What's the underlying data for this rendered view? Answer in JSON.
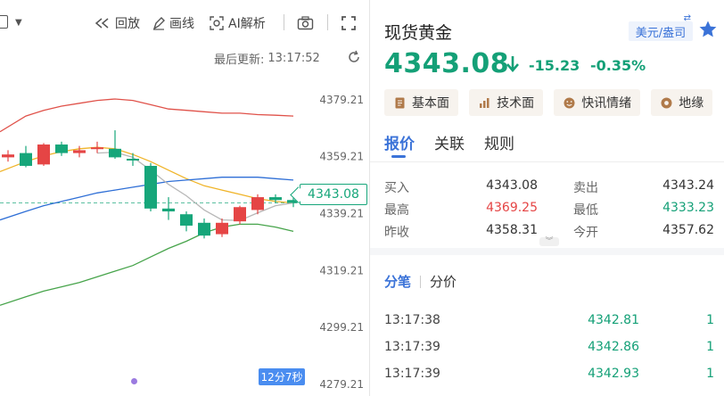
{
  "toolbar": {
    "replay_label": "回放",
    "draw_label": "画线",
    "ai_label": "AI解析"
  },
  "chart": {
    "last_update_label": "最后更新:",
    "last_update_time": "13:17:52",
    "current_price_tag": "4343.08",
    "countdown": "12分7秒"
  },
  "chart_data": {
    "type": "line",
    "title": "",
    "y_tick_labels": [
      "4379.21",
      "4359.21",
      "4339.21",
      "4319.21",
      "4299.21",
      "4279.21"
    ],
    "ylim": [
      4279.21,
      4389.21
    ],
    "candles": [
      {
        "open": 4359.0,
        "close": 4360.0,
        "high": 4361.5,
        "low": 4357.5
      },
      {
        "open": 4360.5,
        "close": 4356.0,
        "high": 4363.0,
        "low": 4355.5
      },
      {
        "open": 4356.5,
        "close": 4363.5,
        "high": 4364.0,
        "low": 4356.0
      },
      {
        "open": 4363.5,
        "close": 4360.5,
        "high": 4364.5,
        "low": 4359.5
      },
      {
        "open": 4360.5,
        "close": 4361.5,
        "high": 4363.0,
        "low": 4359.0
      },
      {
        "open": 4362.0,
        "close": 4362.5,
        "high": 4364.5,
        "low": 4360.5
      },
      {
        "open": 4362.0,
        "close": 4359.0,
        "high": 4368.5,
        "low": 4358.5
      },
      {
        "open": 4358.5,
        "close": 4358.0,
        "high": 4360.5,
        "low": 4356.0
      },
      {
        "open": 4356.0,
        "close": 4341.0,
        "high": 4357.0,
        "low": 4340.0
      },
      {
        "open": 4341.0,
        "close": 4340.0,
        "high": 4345.0,
        "low": 4337.0
      },
      {
        "open": 4339.0,
        "close": 4335.0,
        "high": 4340.0,
        "low": 4333.0
      },
      {
        "open": 4336.0,
        "close": 4331.5,
        "high": 4337.5,
        "low": 4330.5
      },
      {
        "open": 4332.0,
        "close": 4336.0,
        "high": 4337.5,
        "low": 4331.0
      },
      {
        "open": 4336.5,
        "close": 4341.5,
        "high": 4342.0,
        "low": 4335.5
      },
      {
        "open": 4340.5,
        "close": 4345.0,
        "high": 4346.0,
        "low": 4339.0
      },
      {
        "open": 4345.0,
        "close": 4344.0,
        "high": 4346.0,
        "low": 4343.0
      },
      {
        "open": 4344.0,
        "close": 4343.0,
        "high": 4345.5,
        "low": 4341.5
      }
    ],
    "series": [
      {
        "color": "#e0524a",
        "values": [
          4368,
          4373.5,
          4375.5,
          4377,
          4378,
          4379,
          4379.5,
          4379,
          4377.5,
          4376,
          4375.5,
          4375,
          4374.5,
          4374.5,
          4374,
          4373.8,
          4373.5
        ]
      },
      {
        "color": "#f0b429",
        "values": [
          4354,
          4357.5,
          4359.5,
          4361,
          4362,
          4362.5,
          4362,
          4360,
          4357.5,
          4354.5,
          4351.5,
          4349,
          4347.5,
          4346,
          4344.5,
          4343.5,
          4343
        ]
      },
      {
        "color": "#2f6fd6",
        "values": [
          4337,
          4340,
          4342,
          4343.5,
          4345,
          4346.5,
          4347.5,
          4348.5,
          4349.5,
          4350.5,
          4351,
          4351.5,
          4352,
          4352,
          4352,
          4351.5,
          4351
        ]
      },
      {
        "color": "#47a44b",
        "values": [
          4307,
          4310,
          4312,
          4313.5,
          4315,
          4317,
          4319,
          4321,
          4324,
          4327,
          4329.5,
          4332.5,
          4334.5,
          4335.5,
          4335.5,
          4334.5,
          4333
        ]
      },
      {
        "color": "#b8b8b8",
        "values": [
          null,
          null,
          null,
          null,
          null,
          4360.5,
          4360.8,
          4359,
          4354.5,
          4349.5,
          4345.5,
          4340.5,
          4337,
          4336.8,
          4339.5,
          4342,
          4343
        ]
      }
    ],
    "colors": {
      "up": "#e54545",
      "down": "#16a67a"
    }
  },
  "quote": {
    "name": "现货黄金",
    "currency": "美元/盎司",
    "last": "4343.08",
    "change": "-15.23",
    "change_pct": "-0.35%",
    "pills": [
      "基本面",
      "技术面",
      "快讯情绪",
      "地缘"
    ],
    "tabs": [
      "报价",
      "关联",
      "规则"
    ],
    "rows": [
      {
        "l1": "买入",
        "v1": "4343.08",
        "l2": "卖出",
        "v2": "4343.24"
      },
      {
        "l1": "最高",
        "v1": "4369.25",
        "l2": "最低",
        "v2": "4333.23"
      },
      {
        "l1": "昨收",
        "v1": "4358.31",
        "l2": "今开",
        "v2": "4357.62"
      }
    ],
    "trade_tabs": [
      "分笔",
      "分价"
    ],
    "trades": [
      {
        "time": "13:17:38",
        "price": "4342.81",
        "vol": "1"
      },
      {
        "time": "13:17:39",
        "price": "4342.86",
        "vol": "1"
      },
      {
        "time": "13:17:39",
        "price": "4342.93",
        "vol": "1"
      }
    ]
  }
}
